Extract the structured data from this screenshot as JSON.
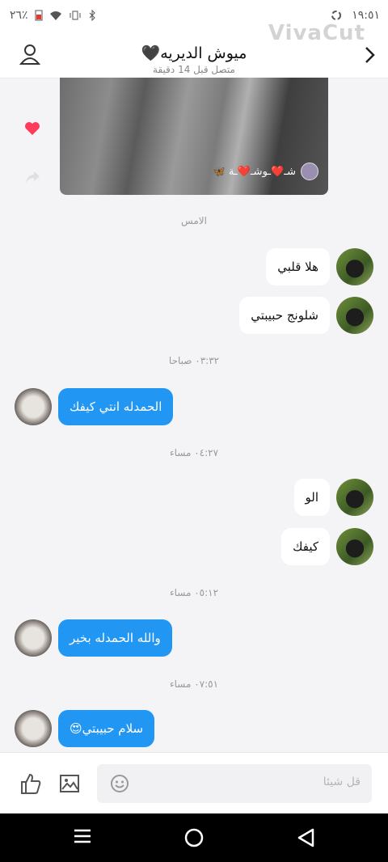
{
  "status": {
    "time": "١٩:٥١",
    "battery": "٢٦٪"
  },
  "header": {
    "title": "ميوش الديريه🖤",
    "subtitle": "متصل قبل 14 دقيقة",
    "watermark": "VivaCut"
  },
  "media": {
    "caption": "شـ❤️ـوشـ❤️ـة 🦋"
  },
  "separators": [
    "الامس",
    "٠٣:٣٢ صباحا",
    "٠٤:٢٧ مساء",
    "٠٥:١٢ مساء",
    "٠٧:٥١ مساء"
  ],
  "messages": [
    {
      "dir": "in",
      "text": "هلا قلبي"
    },
    {
      "dir": "in",
      "text": "شلونج حبيبتي"
    },
    {
      "dir": "out",
      "text": "الحمدله انتي كيفك"
    },
    {
      "dir": "in",
      "text": "الو"
    },
    {
      "dir": "in",
      "text": "كيفك"
    },
    {
      "dir": "out",
      "text": "والله الحمدله بخير"
    },
    {
      "dir": "out",
      "text": "سلام حبيبتي😍"
    }
  ],
  "composer": {
    "placeholder": "قل شيئا"
  },
  "colors": {
    "accent": "#2196f3",
    "heart": "#ff3b5c"
  },
  "icons": [
    "back-icon",
    "profile-icon",
    "heart-icon",
    "share-icon",
    "like-icon",
    "gallery-icon",
    "emoji-icon",
    "menu-icon",
    "home-icon",
    "back-nav-icon"
  ]
}
